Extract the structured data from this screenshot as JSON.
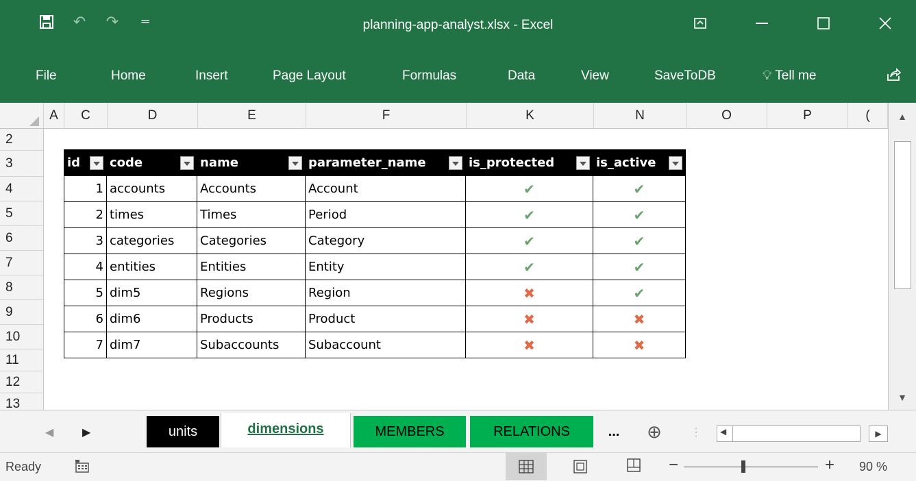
{
  "window": {
    "title": "planning-app-analyst.xlsx  -  Excel",
    "controls": {
      "ribbon_display": "ribbon-display-icon",
      "minimize": "minimize-icon",
      "restore": "restore-icon",
      "close": "close-icon"
    }
  },
  "quick_access": {
    "save": "save-icon",
    "undo": "undo-icon",
    "redo": "redo-icon",
    "customize": "customize-icon"
  },
  "ribbon": {
    "tabs": [
      "File",
      "Home",
      "Insert",
      "Page Layout",
      "Formulas",
      "Data",
      "View",
      "SaveToDB"
    ],
    "tell_me": "Tell me",
    "share": "share-icon"
  },
  "grid": {
    "columns": [
      "A",
      "C",
      "D",
      "E",
      "F",
      "K",
      "N",
      "O",
      "P",
      "("
    ],
    "rows": [
      "2",
      "3",
      "4",
      "5",
      "6",
      "7",
      "8",
      "9",
      "10",
      "11",
      "12",
      "13"
    ]
  },
  "table": {
    "headers": [
      "id",
      "code",
      "name",
      "parameter_name",
      "is_protected",
      "is_active"
    ],
    "rows": [
      {
        "id": "1",
        "code": "accounts",
        "name": "Accounts",
        "parameter_name": "Account",
        "is_protected": true,
        "is_active": true
      },
      {
        "id": "2",
        "code": "times",
        "name": "Times",
        "parameter_name": "Period",
        "is_protected": true,
        "is_active": true
      },
      {
        "id": "3",
        "code": "categories",
        "name": "Categories",
        "parameter_name": "Category",
        "is_protected": true,
        "is_active": true
      },
      {
        "id": "4",
        "code": "entities",
        "name": "Entities",
        "parameter_name": "Entity",
        "is_protected": true,
        "is_active": true
      },
      {
        "id": "5",
        "code": "dim5",
        "name": "Regions",
        "parameter_name": "Region",
        "is_protected": false,
        "is_active": true
      },
      {
        "id": "6",
        "code": "dim6",
        "name": "Products",
        "parameter_name": "Product",
        "is_protected": false,
        "is_active": false
      },
      {
        "id": "7",
        "code": "dim7",
        "name": "Subaccounts",
        "parameter_name": "Subaccount",
        "is_protected": false,
        "is_active": false
      }
    ],
    "mark_true": "✔",
    "mark_false": "✖",
    "colors": {
      "header_bg": "#000000",
      "check": "#6ba36f",
      "cross": "#de6b49"
    }
  },
  "sheet_tabs": {
    "tabs": [
      {
        "label": "units",
        "bg": "#000000",
        "fg": "#ffffff"
      },
      {
        "label": "dimensions",
        "bg": "#ffffff",
        "fg": "#217346"
      },
      {
        "label": "MEMBERS",
        "bg": "#00b050",
        "fg": "#000000"
      },
      {
        "label": "RELATIONS",
        "bg": "#00b050",
        "fg": "#000000"
      }
    ],
    "more": "...",
    "add": "⊕"
  },
  "status_bar": {
    "ready": "Ready",
    "zoom": "90 %",
    "minus": "−",
    "plus": "+"
  },
  "colors": {
    "accent": "#217346"
  }
}
